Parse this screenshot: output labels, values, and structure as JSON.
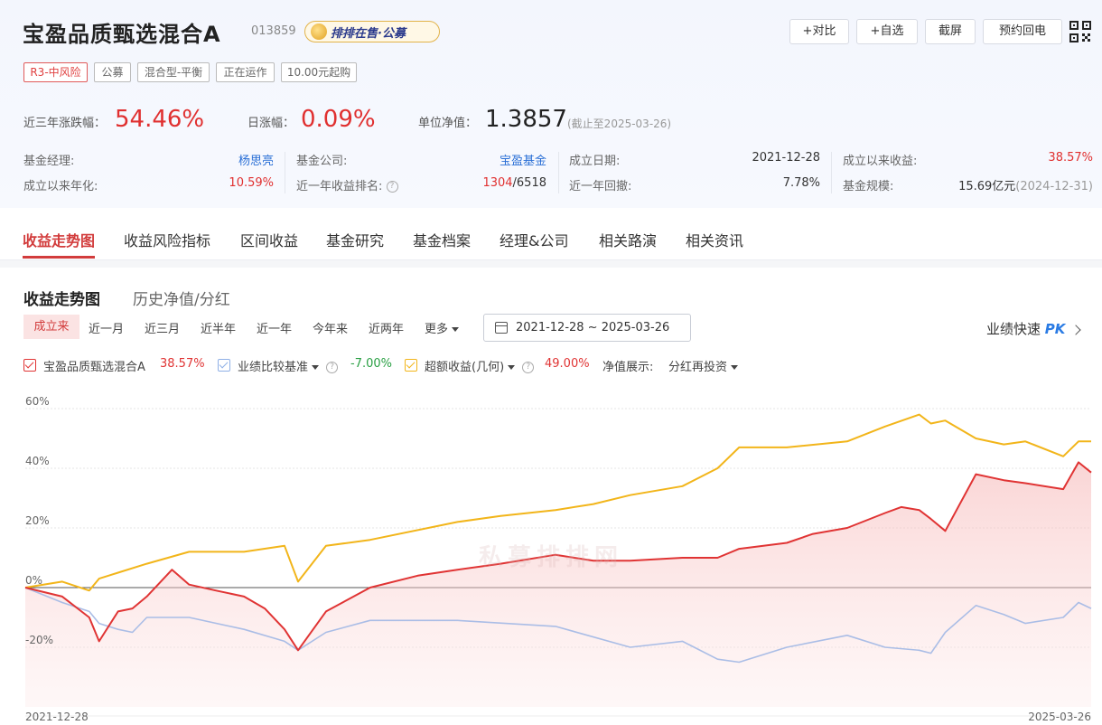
{
  "header": {
    "title": "宝盈品质甄选混合A",
    "code": "013859",
    "sale_badge": "排排在售·公募",
    "buttons": [
      "+对比",
      "+自选",
      "截屏",
      "预约回电"
    ],
    "tags": [
      "R3-中风险",
      "公募",
      "混合型-平衡",
      "正在运作",
      "10.00元起购"
    ]
  },
  "summary": {
    "three_year_label": "近三年涨跌幅：",
    "three_year_value": "54.46%",
    "daily_label": "日涨幅：",
    "daily_value": "0.09%",
    "nav_label": "单位净值：",
    "nav_value": "1.3857",
    "nav_date": "(截止至2025-03-26)"
  },
  "info": {
    "manager_label": "基金经理:",
    "manager_value": "杨思亮",
    "annual_label": "成立以来年化:",
    "annual_value": "10.59%",
    "company_label": "基金公司:",
    "company_value": "宝盈基金",
    "rank_label": "近一年收益排名:",
    "rank_value_a": "1304",
    "rank_value_b": "/6518",
    "found_label": "成立日期:",
    "found_value": "2021-12-28",
    "drawdown_label": "近一年回撤:",
    "drawdown_value": "7.78%",
    "since_label": "成立以来收益:",
    "since_value": "38.57%",
    "scale_label": "基金规模:",
    "scale_value": "15.69亿元",
    "scale_date": "(2024-12-31)"
  },
  "nav": {
    "tabs": [
      "收益走势图",
      "收益风险指标",
      "区间收益",
      "基金研究",
      "基金档案",
      "经理&公司",
      "相关路演",
      "相关资讯"
    ]
  },
  "section": {
    "title_active": "收益走势图",
    "title_other": "历史净值/分红",
    "ranges": [
      "成立来",
      "近一月",
      "近三月",
      "近半年",
      "近一年",
      "今年来",
      "近两年",
      "更多"
    ],
    "date_range": "2021-12-28 ~ 2025-03-26",
    "pk_label": "业绩快速",
    "pk_brand": "PK"
  },
  "legend": {
    "fund_name": "宝盈品质甄选混合A",
    "fund_value": "38.57%",
    "bench_name": "业绩比较基准",
    "bench_value": "-7.00%",
    "excess_name": "超额收益(几何)",
    "excess_value": "49.00%",
    "nav_show_label": "净值展示:",
    "nav_show_value": "分红再投资"
  },
  "watermark": "私募排排网",
  "colors": {
    "fund": "#e03434",
    "bench": "#aabde6",
    "excess": "#f2b51a",
    "accent": "#d23c3c"
  },
  "chart_data": {
    "type": "line",
    "x_start": "2021-12-28",
    "x_end": "2025-03-26",
    "ylim": [
      -40,
      60
    ],
    "y_ticks": [
      "60%",
      "40%",
      "20%",
      "0%",
      "-20%"
    ],
    "series": [
      {
        "name": "宝盈品质甄选混合A",
        "x": [
          "2021-12-28",
          "2022-02-07",
          "2022-03-09",
          "2022-03-20",
          "2022-04-10",
          "2022-04-26",
          "2022-05-12",
          "2022-06-09",
          "2022-06-28",
          "2022-07-28",
          "2022-08-28",
          "2022-09-20",
          "2022-10-12",
          "2022-10-27",
          "2022-11-27",
          "2023-01-15",
          "2023-03-09",
          "2023-04-22",
          "2023-06-09",
          "2023-08-09",
          "2023-09-20",
          "2023-10-31",
          "2023-12-28",
          "2024-02-05",
          "2024-02-29",
          "2024-04-22",
          "2024-05-21",
          "2024-06-28",
          "2024-08-09",
          "2024-08-27",
          "2024-09-16",
          "2024-09-29",
          "2024-10-15",
          "2024-11-18",
          "2024-12-19",
          "2025-01-12",
          "2025-02-23",
          "2025-03-12",
          "2025-03-26"
        ],
        "values": [
          0,
          -3,
          -10,
          -18,
          -8,
          -7,
          -3,
          6,
          1,
          -1,
          -3,
          -7,
          -14,
          -21,
          -8,
          0,
          4,
          6,
          8,
          11,
          9,
          9,
          10,
          10,
          13,
          15,
          18,
          20,
          25,
          27,
          26,
          23,
          19,
          38,
          36,
          35,
          33,
          42,
          38.57
        ]
      },
      {
        "name": "业绩比较基准",
        "x": [
          "2021-12-28",
          "2022-02-07",
          "2022-03-09",
          "2022-03-20",
          "2022-04-10",
          "2022-04-26",
          "2022-05-12",
          "2022-06-28",
          "2022-08-28",
          "2022-10-12",
          "2022-10-27",
          "2022-11-27",
          "2023-01-15",
          "2023-04-22",
          "2023-08-09",
          "2023-10-31",
          "2023-12-28",
          "2024-02-05",
          "2024-02-29",
          "2024-04-22",
          "2024-06-28",
          "2024-08-09",
          "2024-09-16",
          "2024-09-29",
          "2024-10-15",
          "2024-11-18",
          "2024-12-19",
          "2025-01-12",
          "2025-02-23",
          "2025-03-12",
          "2025-03-26"
        ],
        "values": [
          0,
          -5,
          -8,
          -12,
          -14,
          -15,
          -10,
          -10,
          -14,
          -18,
          -21,
          -15,
          -11,
          -11,
          -13,
          -20,
          -18,
          -24,
          -25,
          -20,
          -16,
          -20,
          -21,
          -22,
          -15,
          -6,
          -9,
          -12,
          -10,
          -5,
          -7
        ]
      },
      {
        "name": "超额收益(几何)",
        "x": [
          "2021-12-28",
          "2022-02-07",
          "2022-03-09",
          "2022-03-20",
          "2022-04-10",
          "2022-05-12",
          "2022-06-28",
          "2022-08-28",
          "2022-10-12",
          "2022-10-27",
          "2022-11-27",
          "2023-01-15",
          "2023-04-22",
          "2023-06-09",
          "2023-08-09",
          "2023-09-20",
          "2023-10-31",
          "2023-12-28",
          "2024-02-05",
          "2024-02-29",
          "2024-04-22",
          "2024-06-28",
          "2024-08-09",
          "2024-09-16",
          "2024-09-29",
          "2024-10-15",
          "2024-11-18",
          "2024-12-19",
          "2025-01-12",
          "2025-02-23",
          "2025-03-12",
          "2025-03-26"
        ],
        "values": [
          0,
          2,
          -1,
          3,
          5,
          8,
          12,
          12,
          14,
          2,
          14,
          16,
          22,
          24,
          26,
          28,
          31,
          34,
          40,
          47,
          47,
          49,
          54,
          58,
          55,
          56,
          50,
          48,
          49,
          44,
          49,
          49
        ]
      }
    ]
  }
}
